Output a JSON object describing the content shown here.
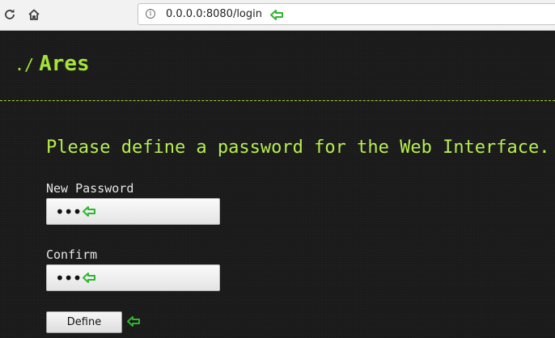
{
  "browser": {
    "url": "0.0.0.0:8080/login",
    "reload_icon": "reload-icon",
    "home_icon": "home-icon",
    "info_icon": "info-icon",
    "info_glyph": "i"
  },
  "app": {
    "logo_prefix": "./",
    "logo_name": "Ares",
    "accent_color": "#a6e33a"
  },
  "form": {
    "prompt": "Please define a password for the Web Interface.",
    "new_password_label": "New Password",
    "new_password_value": "•••",
    "confirm_label": "Confirm",
    "confirm_value": "•••",
    "submit_label": "Define"
  },
  "annotations": {
    "arrow_icon": "green-left-arrow-icon",
    "arrow_color": "#2fb52f"
  }
}
